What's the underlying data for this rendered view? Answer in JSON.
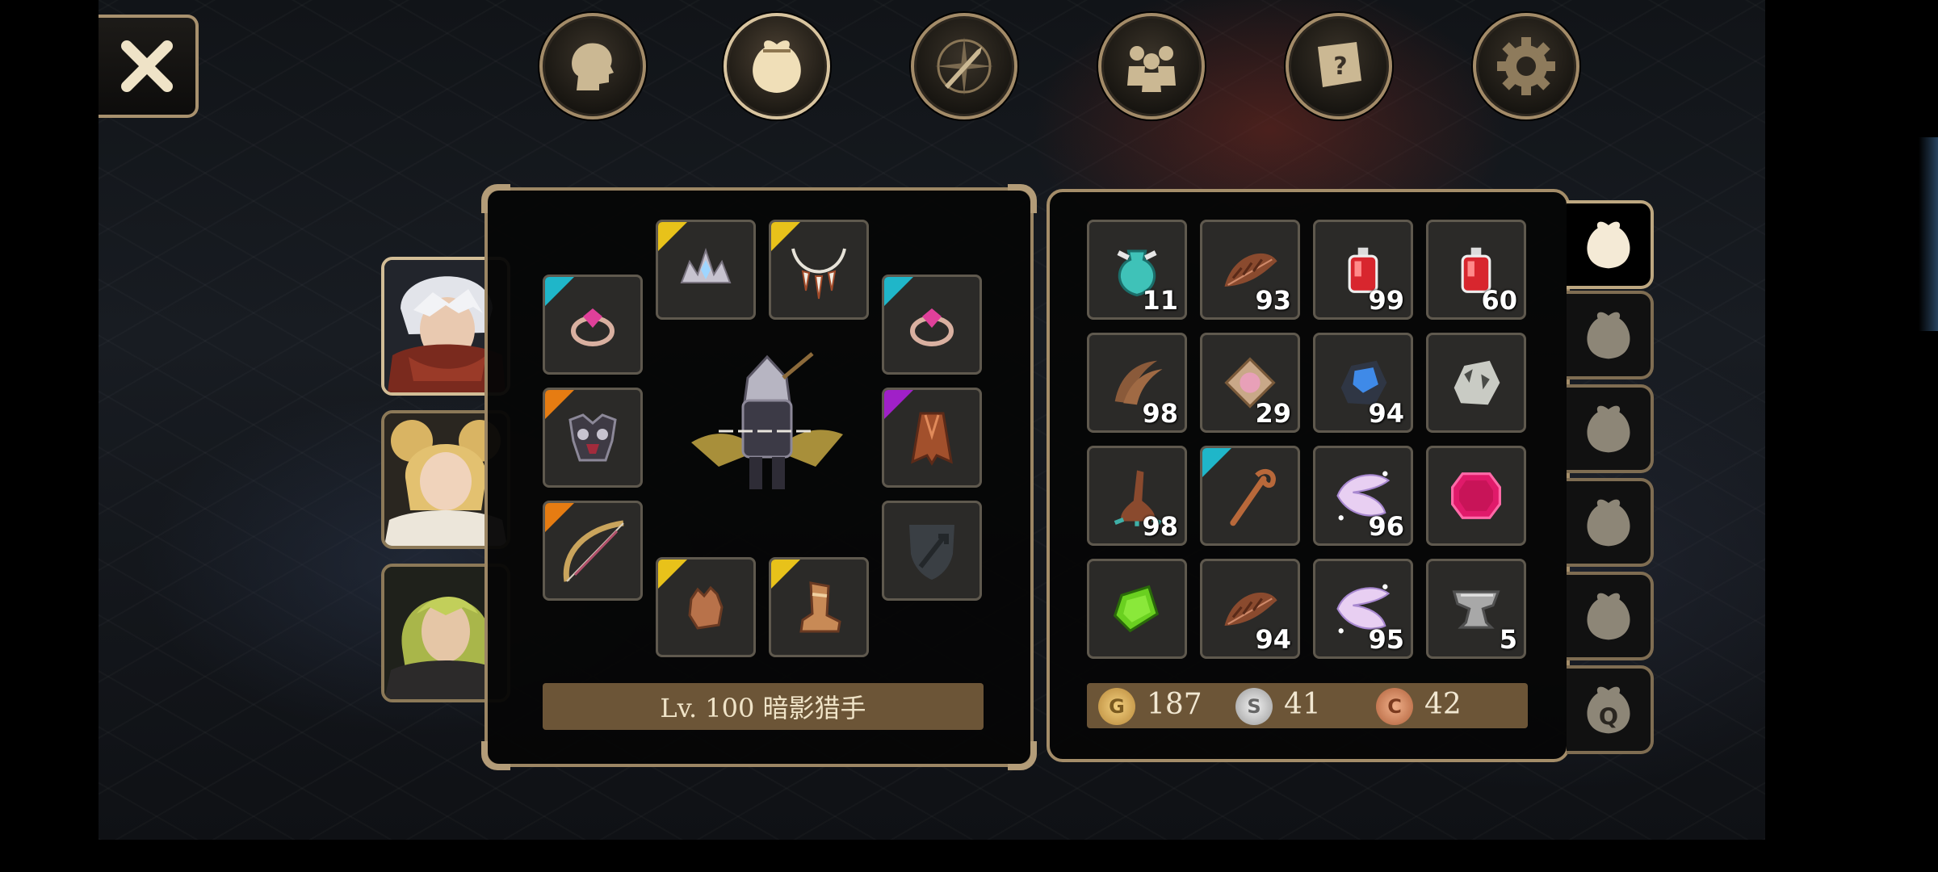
{
  "top_menu": [
    {
      "id": "character",
      "icon": "head-silhouette-icon",
      "active": false
    },
    {
      "id": "inventory",
      "icon": "bag-icon",
      "active": true
    },
    {
      "id": "skills",
      "icon": "sword-compass-icon",
      "active": false
    },
    {
      "id": "party",
      "icon": "group-icon",
      "active": false
    },
    {
      "id": "quests",
      "icon": "scroll-question-icon",
      "active": false
    },
    {
      "id": "settings",
      "icon": "gear-icon",
      "active": false
    }
  ],
  "character": {
    "label": "Lv. 100 暗影猎手"
  },
  "equipment": [
    {
      "slot": "ring-left",
      "icon": "pink-gem-ring-icon",
      "rarity": "#1fb6c9"
    },
    {
      "slot": "head",
      "icon": "crystal-tiara-icon",
      "rarity": "#e8c21a"
    },
    {
      "slot": "neck",
      "icon": "fang-necklace-icon",
      "rarity": "#e8c21a"
    },
    {
      "slot": "ring-right",
      "icon": "pink-gem-ring-icon",
      "rarity": "#1fb6c9"
    },
    {
      "slot": "armor",
      "icon": "dark-armor-icon",
      "rarity": "#e67c12"
    },
    {
      "slot": "cloak",
      "icon": "red-cloak-icon",
      "rarity": "#a020c8"
    },
    {
      "slot": "weapon",
      "icon": "bow-icon",
      "rarity": "#e67c12"
    },
    {
      "slot": "offhand",
      "icon": "shield-sword-placeholder-icon",
      "rarity": ""
    },
    {
      "slot": "gloves",
      "icon": "glove-icon",
      "rarity": "#e8c21a"
    },
    {
      "slot": "boots",
      "icon": "boot-icon",
      "rarity": "#e8c21a"
    }
  ],
  "inventory": [
    {
      "icon": "teal-vase-icon",
      "qty": "11",
      "rarity": ""
    },
    {
      "icon": "brown-feather-icon",
      "qty": "93",
      "rarity": ""
    },
    {
      "icon": "red-potion-icon",
      "qty": "99",
      "rarity": ""
    },
    {
      "icon": "red-potion-icon",
      "qty": "60",
      "rarity": ""
    },
    {
      "icon": "claw-icon",
      "qty": "98",
      "rarity": ""
    },
    {
      "icon": "pink-scroll-icon",
      "qty": "29",
      "rarity": ""
    },
    {
      "icon": "blue-ore-icon",
      "qty": "94",
      "rarity": ""
    },
    {
      "icon": "silver-ore-icon",
      "qty": "",
      "rarity": ""
    },
    {
      "icon": "root-icon",
      "qty": "98",
      "rarity": ""
    },
    {
      "icon": "wooden-staff-icon",
      "qty": "",
      "rarity": "#1fb6c9"
    },
    {
      "icon": "spirit-wings-icon",
      "qty": "96",
      "rarity": ""
    },
    {
      "icon": "pink-gem-icon",
      "qty": "",
      "rarity": ""
    },
    {
      "icon": "green-gem-icon",
      "qty": "",
      "rarity": ""
    },
    {
      "icon": "brown-feather-icon",
      "qty": "94",
      "rarity": ""
    },
    {
      "icon": "spirit-wings-icon",
      "qty": "95",
      "rarity": ""
    },
    {
      "icon": "anvil-icon",
      "qty": "5",
      "rarity": ""
    }
  ],
  "currency": {
    "gold": {
      "symbol": "G",
      "value": "187"
    },
    "silver": {
      "symbol": "S",
      "value": "41"
    },
    "copper": {
      "symbol": "C",
      "value": "42"
    }
  },
  "bag_tabs": [
    {
      "label": "",
      "active": true
    },
    {
      "label": "",
      "active": false
    },
    {
      "label": "",
      "active": false
    },
    {
      "label": "",
      "active": false
    },
    {
      "label": "",
      "active": false
    },
    {
      "label": "Q",
      "active": false
    }
  ],
  "colors": {
    "gold_frame": "#a38b68",
    "label_bar": "#6c5537",
    "slot_bg": "#2b2a28"
  }
}
